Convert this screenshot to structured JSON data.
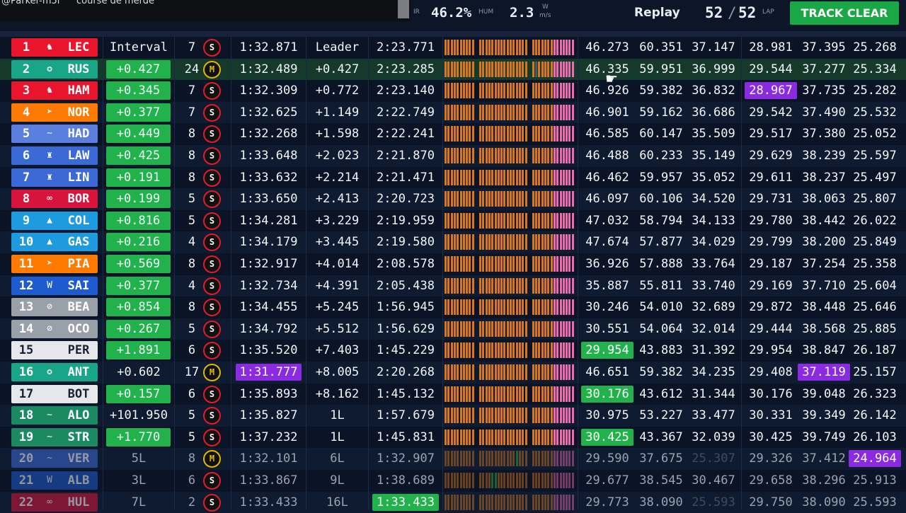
{
  "chat": {
    "name": "@Parker-m5l",
    "message": "course de merde"
  },
  "header": {
    "ir_label": "IR",
    "humidity": "46.2%",
    "hum_label": "HUM",
    "wind": "2.3",
    "wind_label": "W",
    "wind_unit": "m/s",
    "mode": "Replay",
    "lap_current": "52",
    "lap_sep": "/",
    "lap_total": "52",
    "lap_label": "LAP",
    "track_button": "TRACK CLEAR"
  },
  "colors": {
    "purple": "#8a2be2",
    "green": "#21b24c",
    "soft": "#e11d2b",
    "medium": "#e0b800"
  },
  "rows": [
    {
      "pos": "1",
      "code": "LEC",
      "team": "ferrari",
      "teamColor": "#e8152c",
      "logo": "♞",
      "interval": "Interval",
      "ivStyle": "plain",
      "laps": "7",
      "tyre": "S",
      "best": "1:32.871",
      "bestStyle": "",
      "gap": "Leader",
      "last": "2:23.771",
      "lastStyle": "",
      "s1": "46.273",
      "s1Style": "",
      "s2": "60.351",
      "s3": "37.147",
      "b1": "28.981",
      "b1Style": "",
      "b2": "37.395",
      "b2Style": "",
      "b3": "25.268",
      "b3Style": ""
    },
    {
      "pos": "2",
      "code": "RUS",
      "team": "mercedes",
      "teamColor": "#18a588",
      "logo": "✪",
      "interval": "+0.427",
      "ivStyle": "green",
      "laps": "24",
      "tyre": "M",
      "best": "1:32.489",
      "bestStyle": "",
      "gap": "+0.427",
      "last": "2:23.285",
      "lastStyle": "",
      "s1": "46.335",
      "s1Style": "",
      "s2": "59.951",
      "s3": "36.999",
      "b1": "29.544",
      "b1Style": "",
      "b2": "37.277",
      "b2Style": "",
      "b3": "25.334",
      "b3Style": ""
    },
    {
      "pos": "3",
      "code": "HAM",
      "team": "ferrari",
      "teamColor": "#e8152c",
      "logo": "♞",
      "interval": "+0.345",
      "ivStyle": "green",
      "laps": "7",
      "tyre": "S",
      "best": "1:32.309",
      "bestStyle": "",
      "gap": "+0.772",
      "last": "2:23.140",
      "lastStyle": "",
      "s1": "46.926",
      "s1Style": "",
      "s2": "59.382",
      "s3": "36.832",
      "b1": "28.967",
      "b1Style": "purple",
      "b2": "37.735",
      "b2Style": "",
      "b3": "25.282",
      "b3Style": ""
    },
    {
      "pos": "4",
      "code": "NOR",
      "team": "mclaren",
      "teamColor": "#ff7a00",
      "logo": "➤",
      "interval": "+0.377",
      "ivStyle": "green",
      "laps": "7",
      "tyre": "S",
      "best": "1:32.625",
      "bestStyle": "",
      "gap": "+1.149",
      "last": "2:22.749",
      "lastStyle": "",
      "s1": "46.901",
      "s1Style": "",
      "s2": "59.162",
      "s3": "36.686",
      "b1": "29.542",
      "b1Style": "",
      "b2": "37.490",
      "b2Style": "",
      "b3": "25.532",
      "b3Style": ""
    },
    {
      "pos": "5",
      "code": "HAD",
      "team": "racingbulls",
      "teamColor": "#5b7fdc",
      "logo": "~",
      "interval": "+0.449",
      "ivStyle": "green",
      "laps": "8",
      "tyre": "S",
      "best": "1:32.268",
      "bestStyle": "",
      "gap": "+1.598",
      "last": "2:22.241",
      "lastStyle": "",
      "s1": "46.585",
      "s1Style": "",
      "s2": "60.147",
      "s3": "35.509",
      "b1": "29.517",
      "b1Style": "",
      "b2": "37.380",
      "b2Style": "",
      "b3": "25.052",
      "b3Style": ""
    },
    {
      "pos": "6",
      "code": "LAW",
      "team": "redbull",
      "teamColor": "#3b6ad6",
      "logo": "♜",
      "interval": "+0.425",
      "ivStyle": "green",
      "laps": "8",
      "tyre": "S",
      "best": "1:33.648",
      "bestStyle": "",
      "gap": "+2.023",
      "last": "2:21.870",
      "lastStyle": "",
      "s1": "46.488",
      "s1Style": "",
      "s2": "60.233",
      "s3": "35.149",
      "b1": "29.629",
      "b1Style": "",
      "b2": "38.239",
      "b2Style": "",
      "b3": "25.597",
      "b3Style": ""
    },
    {
      "pos": "7",
      "code": "LIN",
      "team": "redbull",
      "teamColor": "#3b6ad6",
      "logo": "♜",
      "interval": "+0.191",
      "ivStyle": "green",
      "laps": "8",
      "tyre": "S",
      "best": "1:33.632",
      "bestStyle": "",
      "gap": "+2.214",
      "last": "2:21.471",
      "lastStyle": "",
      "s1": "46.462",
      "s1Style": "",
      "s2": "59.957",
      "s3": "35.052",
      "b1": "29.611",
      "b1Style": "",
      "b2": "38.237",
      "b2Style": "",
      "b3": "25.497",
      "b3Style": ""
    },
    {
      "pos": "8",
      "code": "BOR",
      "team": "sauber",
      "teamColor": "#d9143c",
      "logo": "∞",
      "interval": "+0.199",
      "ivStyle": "green",
      "laps": "5",
      "tyre": "S",
      "best": "1:33.650",
      "bestStyle": "",
      "gap": "+2.413",
      "last": "2:20.723",
      "lastStyle": "",
      "s1": "46.097",
      "s1Style": "",
      "s2": "60.106",
      "s3": "34.520",
      "b1": "29.731",
      "b1Style": "",
      "b2": "38.063",
      "b2Style": "",
      "b3": "25.807",
      "b3Style": ""
    },
    {
      "pos": "9",
      "code": "COL",
      "team": "alpine",
      "teamColor": "#1e9be0",
      "logo": "▲",
      "interval": "+0.816",
      "ivStyle": "green",
      "laps": "5",
      "tyre": "S",
      "best": "1:34.281",
      "bestStyle": "",
      "gap": "+3.229",
      "last": "2:19.959",
      "lastStyle": "",
      "s1": "47.032",
      "s1Style": "",
      "s2": "58.794",
      "s3": "34.133",
      "b1": "29.780",
      "b1Style": "",
      "b2": "38.442",
      "b2Style": "",
      "b3": "26.022",
      "b3Style": ""
    },
    {
      "pos": "10",
      "code": "GAS",
      "team": "alpine",
      "teamColor": "#1e9be0",
      "logo": "▲",
      "interval": "+0.216",
      "ivStyle": "green",
      "laps": "4",
      "tyre": "S",
      "best": "1:34.179",
      "bestStyle": "",
      "gap": "+3.445",
      "last": "2:19.580",
      "lastStyle": "",
      "s1": "47.674",
      "s1Style": "",
      "s2": "57.877",
      "s3": "34.029",
      "b1": "29.799",
      "b1Style": "",
      "b2": "38.200",
      "b2Style": "",
      "b3": "25.849",
      "b3Style": ""
    },
    {
      "pos": "11",
      "code": "PIA",
      "team": "mclaren",
      "teamColor": "#ff7a00",
      "logo": "➤",
      "interval": "+0.569",
      "ivStyle": "green",
      "laps": "8",
      "tyre": "S",
      "best": "1:32.917",
      "bestStyle": "",
      "gap": "+4.014",
      "last": "2:08.578",
      "lastStyle": "",
      "s1": "36.926",
      "s1Style": "",
      "s2": "57.888",
      "s3": "33.764",
      "b1": "29.187",
      "b1Style": "",
      "b2": "37.254",
      "b2Style": "",
      "b3": "25.358",
      "b3Style": ""
    },
    {
      "pos": "12",
      "code": "SAI",
      "team": "williams",
      "teamColor": "#1f5bd0",
      "logo": "W",
      "interval": "+0.377",
      "ivStyle": "green",
      "laps": "4",
      "tyre": "S",
      "best": "1:32.734",
      "bestStyle": "",
      "gap": "+4.391",
      "last": "2:05.438",
      "lastStyle": "",
      "s1": "35.887",
      "s1Style": "",
      "s2": "55.811",
      "s3": "33.740",
      "b1": "29.169",
      "b1Style": "",
      "b2": "37.710",
      "b2Style": "",
      "b3": "25.604",
      "b3Style": ""
    },
    {
      "pos": "13",
      "code": "BEA",
      "team": "haas",
      "teamColor": "#9aa0a8",
      "logo": "⊘",
      "interval": "+0.854",
      "ivStyle": "green",
      "laps": "8",
      "tyre": "S",
      "best": "1:34.455",
      "bestStyle": "",
      "gap": "+5.245",
      "last": "1:56.945",
      "lastStyle": "",
      "s1": "30.246",
      "s1Style": "",
      "s2": "54.010",
      "s3": "32.689",
      "b1": "29.872",
      "b1Style": "",
      "b2": "38.448",
      "b2Style": "",
      "b3": "25.646",
      "b3Style": ""
    },
    {
      "pos": "14",
      "code": "OCO",
      "team": "haas",
      "teamColor": "#9aa0a8",
      "logo": "⊘",
      "interval": "+0.267",
      "ivStyle": "green",
      "laps": "5",
      "tyre": "S",
      "best": "1:34.792",
      "bestStyle": "",
      "gap": "+5.512",
      "last": "1:56.629",
      "lastStyle": "",
      "s1": "30.551",
      "s1Style": "",
      "s2": "54.064",
      "s3": "32.014",
      "b1": "29.444",
      "b1Style": "",
      "b2": "38.568",
      "b2Style": "",
      "b3": "25.885",
      "b3Style": ""
    },
    {
      "pos": "15",
      "code": "PER",
      "team": "cadillac",
      "teamColor": "#e6e7ea",
      "logo": "",
      "interval": "+1.891",
      "ivStyle": "green",
      "laps": "6",
      "tyre": "S",
      "best": "1:35.520",
      "bestStyle": "",
      "gap": "+7.403",
      "last": "1:45.229",
      "lastStyle": "",
      "s1": "29.954",
      "s1Style": "green",
      "s2": "43.883",
      "s3": "31.392",
      "b1": "29.954",
      "b1Style": "",
      "b2": "38.847",
      "b2Style": "",
      "b3": "26.187",
      "b3Style": ""
    },
    {
      "pos": "16",
      "code": "ANT",
      "team": "mercedes",
      "teamColor": "#18a588",
      "logo": "✪",
      "interval": "+0.602",
      "ivStyle": "plain",
      "laps": "17",
      "tyre": "M",
      "best": "1:31.777",
      "bestStyle": "purple",
      "gap": "+8.005",
      "last": "2:20.268",
      "lastStyle": "",
      "s1": "46.651",
      "s1Style": "",
      "s2": "59.382",
      "s3": "34.235",
      "b1": "29.408",
      "b1Style": "",
      "b2": "37.119",
      "b2Style": "purple",
      "b3": "25.157",
      "b3Style": ""
    },
    {
      "pos": "17",
      "code": "BOT",
      "team": "cadillac",
      "teamColor": "#e6e7ea",
      "logo": "",
      "interval": "+0.157",
      "ivStyle": "green",
      "laps": "6",
      "tyre": "S",
      "best": "1:35.893",
      "bestStyle": "",
      "gap": "+8.162",
      "last": "1:45.132",
      "lastStyle": "",
      "s1": "30.176",
      "s1Style": "green",
      "s2": "43.612",
      "s3": "31.344",
      "b1": "30.176",
      "b1Style": "",
      "b2": "39.048",
      "b2Style": "",
      "b3": "26.323",
      "b3Style": ""
    },
    {
      "pos": "18",
      "code": "ALO",
      "team": "aston",
      "teamColor": "#1b8a63",
      "logo": "~",
      "interval": "+101.950",
      "ivStyle": "plain",
      "laps": "5",
      "tyre": "S",
      "best": "1:35.827",
      "bestStyle": "",
      "gap": "1L",
      "last": "1:57.679",
      "lastStyle": "",
      "s1": "30.975",
      "s1Style": "",
      "s2": "53.227",
      "s3": "33.477",
      "b1": "30.331",
      "b1Style": "",
      "b2": "39.349",
      "b2Style": "",
      "b3": "26.142",
      "b3Style": ""
    },
    {
      "pos": "19",
      "code": "STR",
      "team": "aston",
      "teamColor": "#1b8a63",
      "logo": "~",
      "interval": "+1.770",
      "ivStyle": "green",
      "laps": "5",
      "tyre": "S",
      "best": "1:37.232",
      "bestStyle": "",
      "gap": "1L",
      "last": "1:45.831",
      "lastStyle": "",
      "s1": "30.425",
      "s1Style": "green",
      "s2": "43.367",
      "s3": "32.039",
      "b1": "30.425",
      "b1Style": "",
      "b2": "39.749",
      "b2Style": "",
      "b3": "26.103",
      "b3Style": ""
    },
    {
      "pos": "20",
      "code": "VER",
      "team": "redbull",
      "teamColor": "#3b6ad6",
      "logo": "~",
      "interval": "5L",
      "ivStyle": "plain",
      "laps": "8",
      "tyre": "M",
      "best": "1:32.101",
      "bestStyle": "",
      "gap": "6L",
      "last": "1:32.907",
      "lastStyle": "",
      "s1": "29.590",
      "s1Style": "",
      "s2": "37.675",
      "s3": "25.307",
      "b1": "29.326",
      "b1Style": "",
      "b2": "37.412",
      "b2Style": "",
      "b3": "24.964",
      "b3Style": "purple"
    },
    {
      "pos": "21",
      "code": "ALB",
      "team": "williams",
      "teamColor": "#1f5bd0",
      "logo": "W",
      "interval": "3L",
      "ivStyle": "plain",
      "laps": "6",
      "tyre": "S",
      "best": "1:33.867",
      "bestStyle": "",
      "gap": "9L",
      "last": "1:38.689",
      "lastStyle": "",
      "s1": "29.677",
      "s1Style": "",
      "s2": "38.545",
      "s3": "30.467",
      "b1": "29.658",
      "b1Style": "",
      "b2": "38.296",
      "b2Style": "",
      "b3": "25.913",
      "b3Style": ""
    },
    {
      "pos": "22",
      "code": "HUL",
      "team": "sauber",
      "teamColor": "#d9143c",
      "logo": "∞",
      "interval": "7L",
      "ivStyle": "plain",
      "laps": "2",
      "tyre": "S",
      "best": "1:33.433",
      "bestStyle": "",
      "gap": "16L",
      "last": "1:33.433",
      "lastStyle": "green",
      "s1": "29.773",
      "s1Style": "",
      "s2": "38.090",
      "s3": "25.593",
      "b1": "29.750",
      "b1Style": "",
      "b2": "38.090",
      "b2Style": "",
      "b3": "25.593",
      "b3Style": ""
    }
  ]
}
